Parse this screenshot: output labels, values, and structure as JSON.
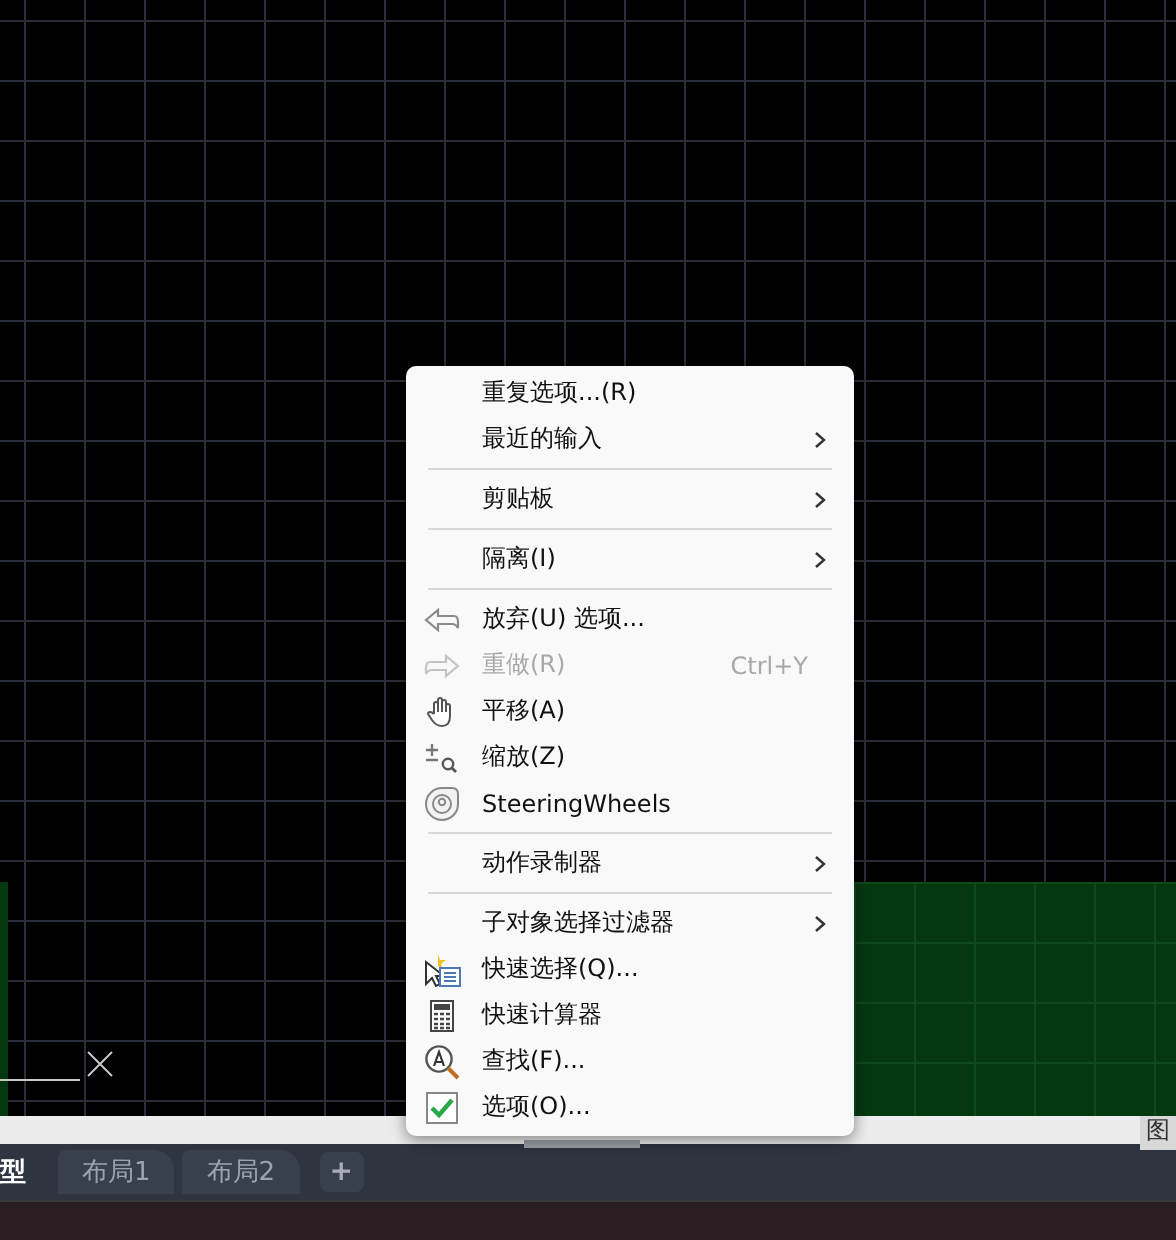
{
  "context_menu": {
    "items": [
      {
        "kind": "plain",
        "label": "重复选项...(R)",
        "submenu": false,
        "disabled": false
      },
      {
        "kind": "plain",
        "label": "最近的输入",
        "submenu": true,
        "disabled": false
      },
      {
        "kind": "separator"
      },
      {
        "kind": "plain",
        "label": "剪贴板",
        "submenu": true,
        "disabled": false
      },
      {
        "kind": "separator"
      },
      {
        "kind": "plain",
        "label": "隔离(I)",
        "submenu": true,
        "disabled": false
      },
      {
        "kind": "separator"
      },
      {
        "kind": "undo",
        "label": "放弃(U) 选项...",
        "submenu": false,
        "disabled": false
      },
      {
        "kind": "redo",
        "label": "重做(R)",
        "submenu": false,
        "disabled": true,
        "shortcut": "Ctrl+Y"
      },
      {
        "kind": "pan",
        "label": "平移(A)",
        "submenu": false,
        "disabled": false
      },
      {
        "kind": "zoom",
        "label": "缩放(Z)",
        "submenu": false,
        "disabled": false
      },
      {
        "kind": "wheel",
        "label": "SteeringWheels",
        "submenu": false,
        "disabled": false
      },
      {
        "kind": "separator"
      },
      {
        "kind": "plain",
        "label": "动作录制器",
        "submenu": true,
        "disabled": false
      },
      {
        "kind": "separator"
      },
      {
        "kind": "plain",
        "label": "子对象选择过滤器",
        "submenu": true,
        "disabled": false
      },
      {
        "kind": "quickselect",
        "label": "快速选择(Q)...",
        "submenu": false,
        "disabled": false
      },
      {
        "kind": "calculator",
        "label": "快速计算器",
        "submenu": false,
        "disabled": false
      },
      {
        "kind": "find",
        "label": "查找(F)...",
        "submenu": false,
        "disabled": false
      },
      {
        "kind": "check",
        "label": "选项(O)...",
        "submenu": false,
        "disabled": false
      }
    ]
  },
  "side_label": "图",
  "layout_tabs": [
    {
      "label": "型",
      "selected": true
    },
    {
      "label": "布局1",
      "selected": false
    },
    {
      "label": "布局2",
      "selected": false
    }
  ],
  "add_tab": {
    "label": "+"
  }
}
